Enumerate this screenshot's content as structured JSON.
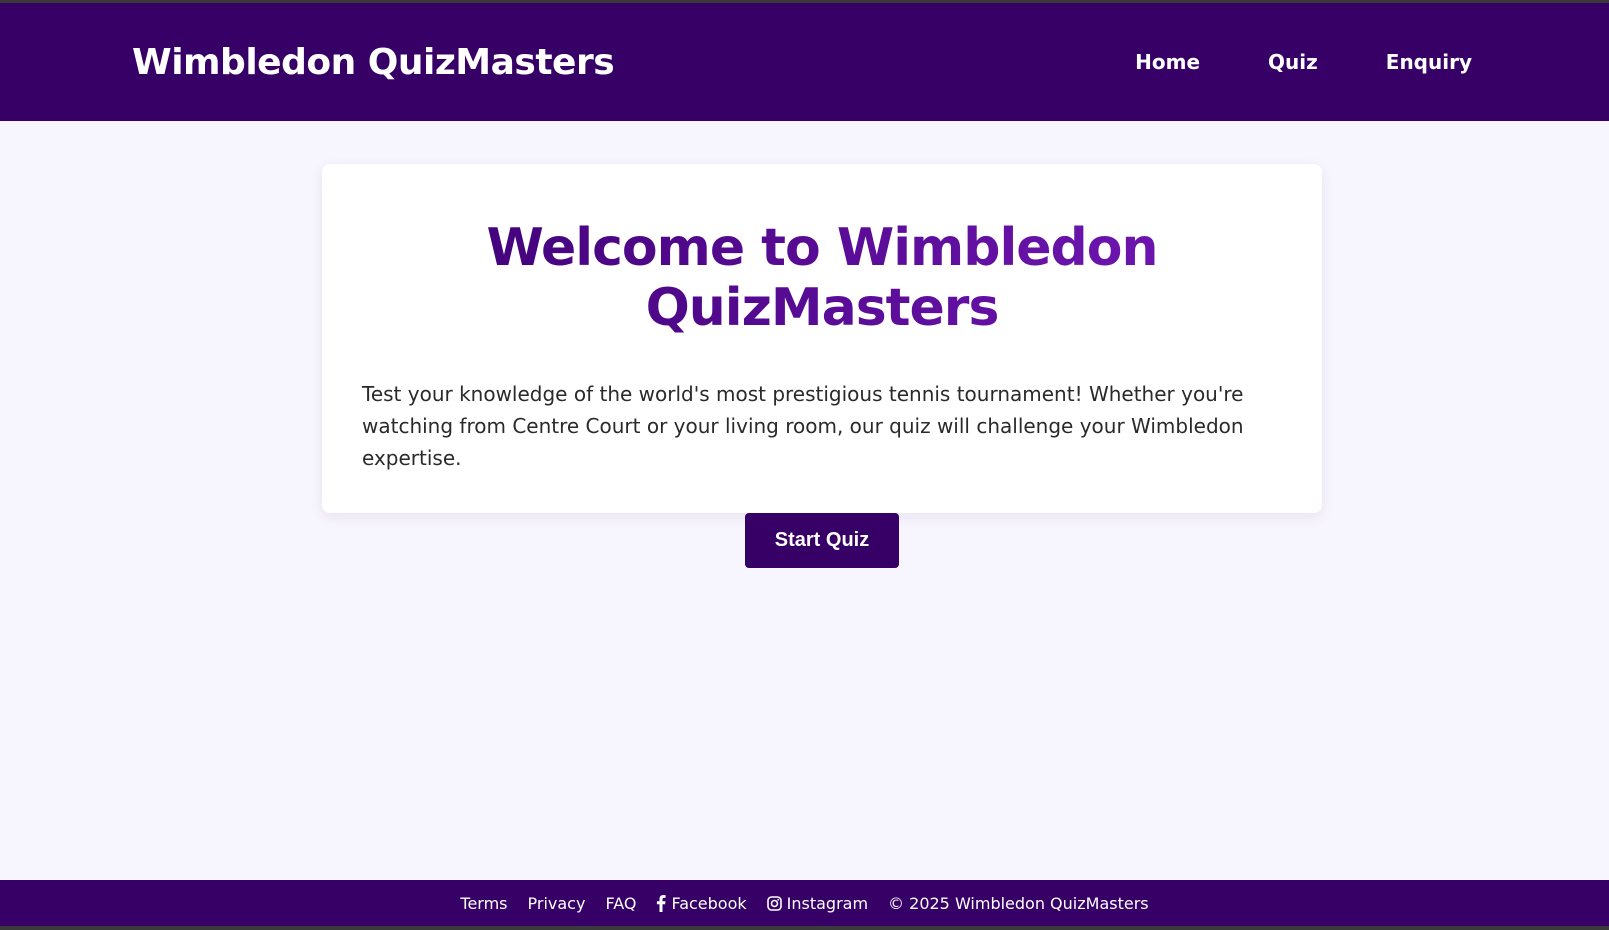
{
  "header": {
    "brand": "Wimbledon QuizMasters",
    "nav": [
      {
        "label": "Home"
      },
      {
        "label": "Quiz"
      },
      {
        "label": "Enquiry"
      }
    ]
  },
  "main": {
    "title": "Welcome to Wimbledon QuizMasters",
    "intro": "Test your knowledge of the world's most prestigious tennis tournament! Whether you're watching from Centre Court or your living room, our quiz will challenge your Wimbledon expertise.",
    "start_button": "Start Quiz"
  },
  "footer": {
    "terms": "Terms",
    "privacy": "Privacy",
    "faq": "FAQ",
    "facebook": "Facebook",
    "facebook_icon": "facebook-icon",
    "instagram": "Instagram",
    "instagram_icon": "instagram-icon",
    "copyright": "© 2025 Wimbledon QuizMasters"
  },
  "colors": {
    "brand_purple": "#360066",
    "title_gradient_start": "#3d0073",
    "title_gradient_end": "#7418b8",
    "page_bg": "#f7f5fd"
  }
}
